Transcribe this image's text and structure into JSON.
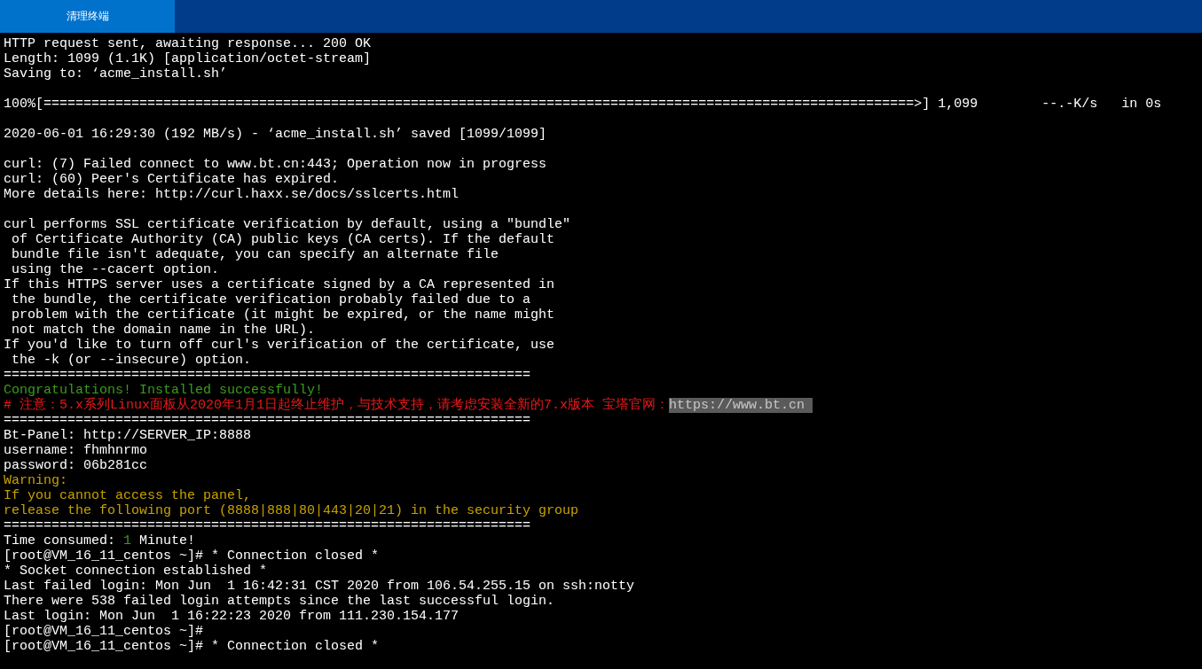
{
  "toolbar": {
    "button": {
      "label": "清理终端"
    }
  },
  "terminal": {
    "lines": [
      {
        "kind": "text",
        "segments": [
          {
            "text": "HTTP request sent, awaiting response... 200 OK",
            "color": "#ffffff"
          }
        ]
      },
      {
        "kind": "text",
        "segments": [
          {
            "text": "Length: 1099 (1.1K) [application/octet-stream]",
            "color": "#ffffff"
          }
        ]
      },
      {
        "kind": "text",
        "segments": [
          {
            "text": "Saving to: ‘acme_install.sh’",
            "color": "#ffffff"
          }
        ]
      },
      {
        "kind": "blank"
      },
      {
        "kind": "text",
        "segments": [
          {
            "text": "100%[=============================================================================================================>] 1,099        --.-K/s   in 0s",
            "color": "#ffffff"
          }
        ]
      },
      {
        "kind": "blank"
      },
      {
        "kind": "text",
        "segments": [
          {
            "text": "2020-06-01 16:29:30 (192 MB/s) - ‘acme_install.sh’ saved [1099/1099]",
            "color": "#ffffff"
          }
        ]
      },
      {
        "kind": "blank"
      },
      {
        "kind": "text",
        "segments": [
          {
            "text": "curl: (7) Failed connect to www.bt.cn:443; Operation now in progress",
            "color": "#ffffff"
          }
        ]
      },
      {
        "kind": "text",
        "segments": [
          {
            "text": "curl: (60) Peer's Certificate has expired.",
            "color": "#ffffff"
          }
        ]
      },
      {
        "kind": "text",
        "segments": [
          {
            "text": "More details here: http://curl.haxx.se/docs/sslcerts.html",
            "color": "#ffffff"
          }
        ]
      },
      {
        "kind": "blank"
      },
      {
        "kind": "text",
        "segments": [
          {
            "text": "curl performs SSL certificate verification by default, using a \"bundle\"",
            "color": "#ffffff"
          }
        ]
      },
      {
        "kind": "text",
        "segments": [
          {
            "text": " of Certificate Authority (CA) public keys (CA certs). If the default",
            "color": "#ffffff"
          }
        ]
      },
      {
        "kind": "text",
        "segments": [
          {
            "text": " bundle file isn't adequate, you can specify an alternate file",
            "color": "#ffffff"
          }
        ]
      },
      {
        "kind": "text",
        "segments": [
          {
            "text": " using the --cacert option.",
            "color": "#ffffff"
          }
        ]
      },
      {
        "kind": "text",
        "segments": [
          {
            "text": "If this HTTPS server uses a certificate signed by a CA represented in",
            "color": "#ffffff"
          }
        ]
      },
      {
        "kind": "text",
        "segments": [
          {
            "text": " the bundle, the certificate verification probably failed due to a",
            "color": "#ffffff"
          }
        ]
      },
      {
        "kind": "text",
        "segments": [
          {
            "text": " problem with the certificate (it might be expired, or the name might",
            "color": "#ffffff"
          }
        ]
      },
      {
        "kind": "text",
        "segments": [
          {
            "text": " not match the domain name in the URL).",
            "color": "#ffffff"
          }
        ]
      },
      {
        "kind": "text",
        "segments": [
          {
            "text": "If you'd like to turn off curl's verification of the certificate, use",
            "color": "#ffffff"
          }
        ]
      },
      {
        "kind": "text",
        "segments": [
          {
            "text": " the -k (or --insecure) option.",
            "color": "#ffffff"
          }
        ]
      },
      {
        "kind": "text",
        "segments": [
          {
            "text": "==================================================================",
            "color": "#ffffff"
          }
        ]
      },
      {
        "kind": "text",
        "segments": [
          {
            "text": "Congratulations! Installed successfully!",
            "color": "#3c9c1c"
          }
        ]
      },
      {
        "kind": "text",
        "segments": [
          {
            "text": "# 注意：5.x系列Linux面板从2020年1月1日起终止维护，与技术支持，请考虑安装全新的7.x版本 宝塔官网：",
            "color": "#e8191b"
          },
          {
            "text": "https://www.bt.cn ",
            "highlighted": true
          }
        ]
      },
      {
        "kind": "text",
        "segments": [
          {
            "text": "==================================================================",
            "color": "#ffffff"
          }
        ]
      },
      {
        "kind": "text",
        "segments": [
          {
            "text": "Bt-Panel: http://SERVER_IP:8888",
            "color": "#ffffff"
          }
        ]
      },
      {
        "kind": "text",
        "segments": [
          {
            "text": "username: fhmhnrmo",
            "color": "#ffffff"
          }
        ]
      },
      {
        "kind": "text",
        "segments": [
          {
            "text": "password: 06b281cc",
            "color": "#ffffff"
          }
        ]
      },
      {
        "kind": "text",
        "segments": [
          {
            "text": "Warning:",
            "color": "#c8a000"
          }
        ]
      },
      {
        "kind": "text",
        "segments": [
          {
            "text": "If you cannot access the panel,",
            "color": "#c8a000"
          }
        ]
      },
      {
        "kind": "text",
        "segments": [
          {
            "text": "release the following port (8888|888|80|443|20|21) in the security group",
            "color": "#c8a000"
          }
        ]
      },
      {
        "kind": "text",
        "segments": [
          {
            "text": "==================================================================",
            "color": "#ffffff"
          }
        ]
      },
      {
        "kind": "text",
        "segments": [
          {
            "text": "Time consumed: ",
            "color": "#ffffff"
          },
          {
            "text": "1",
            "color": "#3c9c1c"
          },
          {
            "text": " Minute!",
            "color": "#ffffff"
          }
        ]
      },
      {
        "kind": "text",
        "segments": [
          {
            "text": "[root@VM_16_11_centos ~]# * Connection closed *",
            "color": "#ffffff"
          }
        ]
      },
      {
        "kind": "text",
        "segments": [
          {
            "text": "* Socket connection established *",
            "color": "#ffffff"
          }
        ]
      },
      {
        "kind": "text",
        "segments": [
          {
            "text": "Last failed login: Mon Jun  1 16:42:31 CST 2020 from 106.54.255.15 on ssh:notty",
            "color": "#ffffff"
          }
        ]
      },
      {
        "kind": "text",
        "segments": [
          {
            "text": "There were 538 failed login attempts since the last successful login.",
            "color": "#ffffff"
          }
        ]
      },
      {
        "kind": "text",
        "segments": [
          {
            "text": "Last login: Mon Jun  1 16:22:23 2020 from 111.230.154.177",
            "color": "#ffffff"
          }
        ]
      },
      {
        "kind": "text",
        "segments": [
          {
            "text": "[root@VM_16_11_centos ~]#",
            "color": "#ffffff"
          }
        ]
      },
      {
        "kind": "text",
        "segments": [
          {
            "text": "[root@VM_16_11_centos ~]# * Connection closed *",
            "color": "#ffffff"
          }
        ]
      }
    ]
  }
}
